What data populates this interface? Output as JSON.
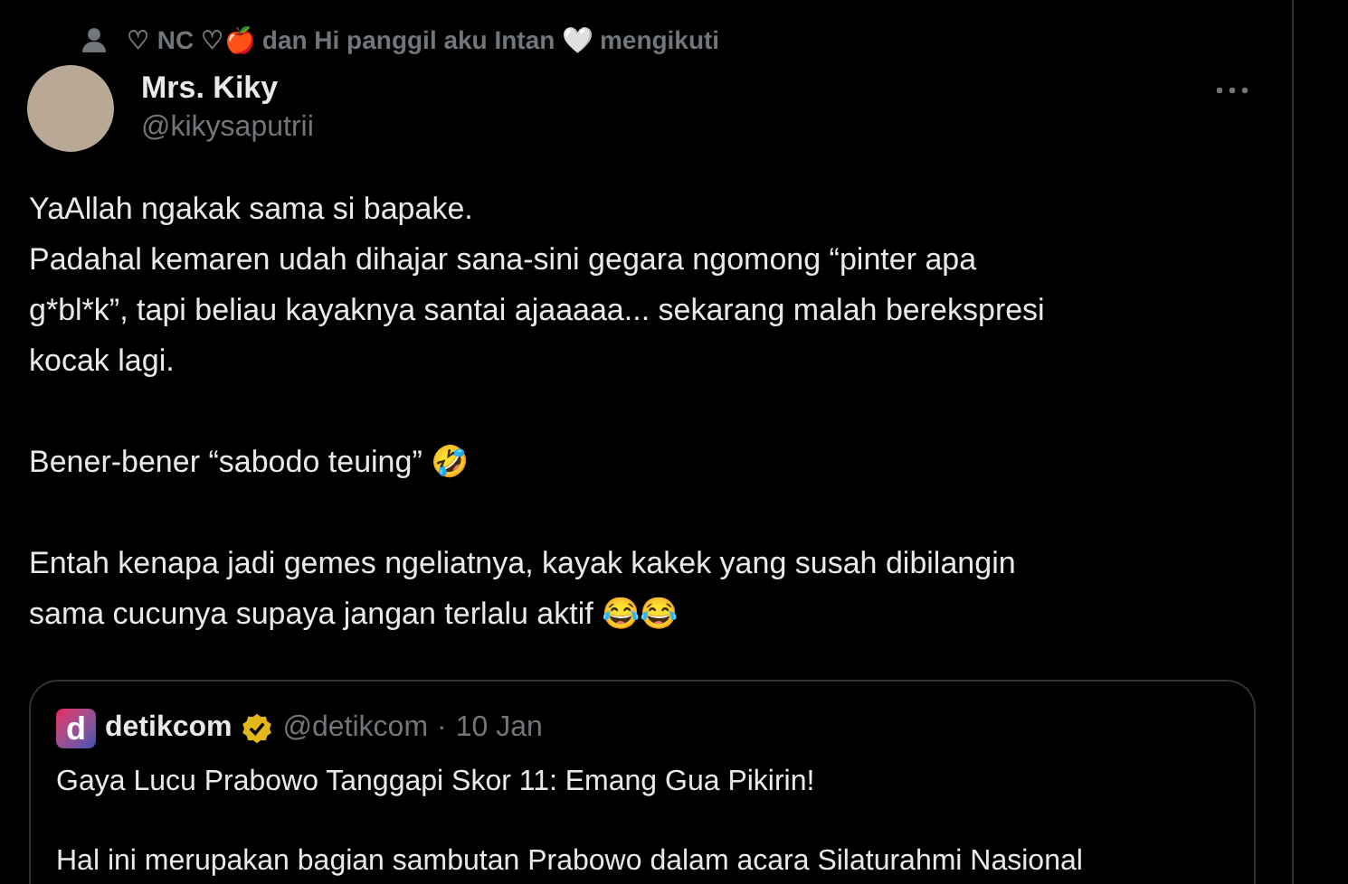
{
  "social_context": "♡ NC ♡🍎 dan Hi panggil aku Intan 🤍 mengikuti",
  "author": {
    "name": "Mrs. Kiky",
    "handle": "@kikysaputrii"
  },
  "paragraphs": [
    "YaAllah ngakak sama si bapake.\nPadahal kemaren udah dihajar sana-sini gegara ngomong “pinter apa\ng*bl*k”, tapi beliau kayaknya santai ajaaaaa... sekarang malah berekspresi\nkocak lagi.",
    "Bener-bener “sabodo teuing” 🤣",
    "Entah kenapa jadi gemes ngeliatnya, kayak kakek yang susah dibilangin\nsama cucunya supaya jangan terlalu aktif 😂😂"
  ],
  "quote": {
    "logo_letter": "d",
    "name": "detikcom",
    "verified": true,
    "handle": "@detikcom",
    "separator": "·",
    "date": "10 Jan",
    "paragraphs": [
      "Gaya Lucu Prabowo Tanggapi Skor 11: Emang Gua Pikirin!",
      "Hal ini merupakan bagian sambutan Prabowo dalam acara Silaturahmi Nasional"
    ]
  }
}
